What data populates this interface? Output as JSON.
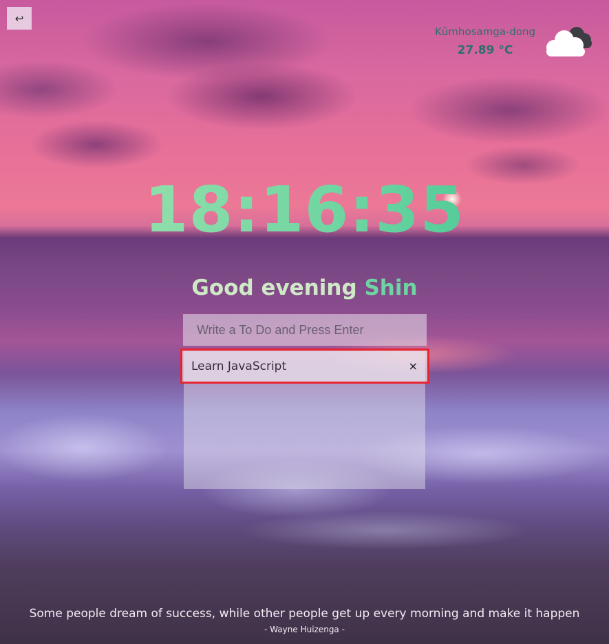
{
  "nav": {
    "back_symbol": "↩"
  },
  "weather": {
    "location": "Kŭmhosamga-dong",
    "temperature": "27.89 °C",
    "icon": "cloud-icon"
  },
  "clock": {
    "time": "18:16:35"
  },
  "greeting": {
    "prefix": "Good evening",
    "name": "Shin"
  },
  "todo": {
    "placeholder": "Write a To Do and Press Enter",
    "items": [
      {
        "text": "Learn JavaScript",
        "delete_symbol": "×"
      }
    ]
  },
  "quote": {
    "text": "Some people dream of success, while other people get up every morning and make it happen",
    "author": "- Wayne Huizenga -"
  },
  "colors": {
    "clock_accent": "#6ad4a0",
    "greeting_light": "#cfe9c6",
    "greeting_name": "#6fd3a2",
    "weather_text": "#2e6f6a",
    "highlight_border": "#e8232e"
  }
}
